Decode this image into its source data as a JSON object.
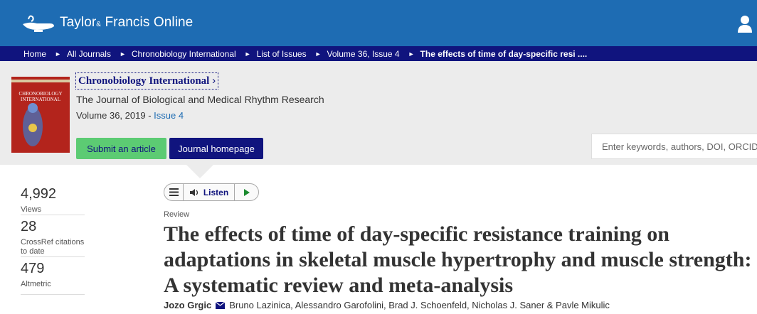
{
  "header": {
    "brand_main": "Taylor",
    "brand_amp": "&",
    "brand_rest": " Francis Online"
  },
  "breadcrumb": [
    "Home",
    "All Journals",
    "Chronobiology International",
    "List of Issues",
    "Volume 36, Issue 4",
    "The effects of time of day-specific resi ...."
  ],
  "journal": {
    "title": "Chronobiology International",
    "title_chevron": "›",
    "subtitle": "The Journal of Biological and Medical Rhythm Research",
    "volume_prefix": "Volume 36, 2019 - ",
    "issue_link": "Issue 4",
    "cover_text": "CHRONOBIOLOGY INTERNATIONAL"
  },
  "buttons": {
    "submit": "Submit an article",
    "homepage": "Journal homepage"
  },
  "search": {
    "placeholder": "Enter keywords, authors, DOI, ORCID"
  },
  "metrics": [
    {
      "value": "4,992",
      "label": "Views"
    },
    {
      "value": "28",
      "label": "CrossRef citations to date"
    },
    {
      "value": "479",
      "label": "Altmetric"
    }
  ],
  "listen": {
    "label": "Listen"
  },
  "article": {
    "type": "Review",
    "title": "The effects of time of day-specific resistance training on adaptations in skeletal muscle hypertrophy and muscle strength: A systematic review and meta-analysis",
    "first_author": "Jozo Grgic",
    "other_authors": "Bruno Lazinica,  Alessandro Garofolini,  Brad J. Schoenfeld,  Nicholas J. Saner & Pavle Mikulic"
  },
  "colors": {
    "header_blue": "#1e6cb3",
    "nav_navy": "#10147e",
    "submit_green": "#5ccb73"
  }
}
